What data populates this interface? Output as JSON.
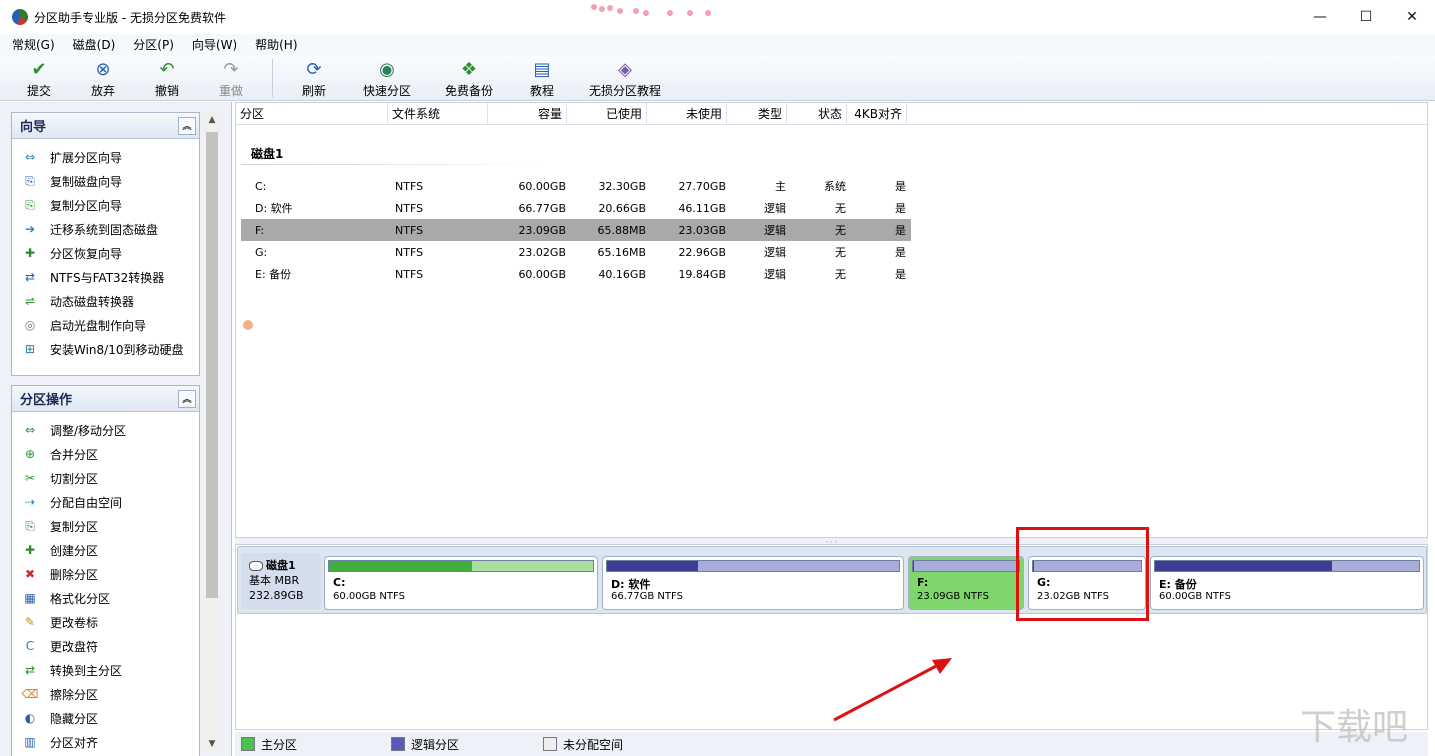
{
  "window": {
    "title": "分区助手专业版 - 无损分区免费软件",
    "minimize": "—",
    "maximize": "☐",
    "close": "✕"
  },
  "menu": [
    "常规(G)",
    "磁盘(D)",
    "分区(P)",
    "向导(W)",
    "帮助(H)"
  ],
  "toolbar": [
    {
      "label": "提交",
      "icon": "check-icon",
      "glyph": "✔",
      "color": "#2f8f2f",
      "enabled": true
    },
    {
      "label": "放弃",
      "icon": "discard-icon",
      "glyph": "⊗",
      "color": "#2a5fb0",
      "enabled": true
    },
    {
      "label": "撤销",
      "icon": "undo-icon",
      "glyph": "↶",
      "color": "#2f8f2f",
      "enabled": true
    },
    {
      "label": "重做",
      "icon": "redo-icon",
      "glyph": "↷",
      "color": "#999999",
      "enabled": false
    },
    {
      "label": "刷新",
      "icon": "refresh-icon",
      "glyph": "⟳",
      "color": "#2a5fb0",
      "enabled": true
    },
    {
      "label": "快速分区",
      "icon": "quick-partition-icon",
      "glyph": "◉",
      "color": "#2a7f5f",
      "enabled": true
    },
    {
      "label": "免费备份",
      "icon": "backup-icon",
      "glyph": "❖",
      "color": "#2f8f2f",
      "enabled": true
    },
    {
      "label": "教程",
      "icon": "tutorial-icon",
      "glyph": "▤",
      "color": "#2a5fb0",
      "enabled": true
    },
    {
      "label": "无损分区教程",
      "icon": "lossless-tutorial-icon",
      "glyph": "◈",
      "color": "#7a5aa0",
      "enabled": true
    }
  ],
  "sidebar": {
    "wizard": {
      "title": "向导",
      "collapse": "︽",
      "items": [
        {
          "label": "扩展分区向导",
          "icon": "extend-partition-icon",
          "glyph": "⇔",
          "color": "#2a7fb0"
        },
        {
          "label": "复制磁盘向导",
          "icon": "copy-disk-icon",
          "glyph": "⎘",
          "color": "#2a5fb0"
        },
        {
          "label": "复制分区向导",
          "icon": "copy-partition-icon",
          "glyph": "⎘",
          "color": "#2f8f2f"
        },
        {
          "label": "迁移系统到固态磁盘",
          "icon": "migrate-os-icon",
          "glyph": "➔",
          "color": "#2a7fb0"
        },
        {
          "label": "分区恢复向导",
          "icon": "partition-recovery-icon",
          "glyph": "✚",
          "color": "#2f8f2f"
        },
        {
          "label": "NTFS与FAT32转换器",
          "icon": "ntfs-fat32-convert-icon",
          "glyph": "⇄",
          "color": "#2a5fb0"
        },
        {
          "label": "动态磁盘转换器",
          "icon": "dynamic-disk-icon",
          "glyph": "⇌",
          "color": "#2f8f2f"
        },
        {
          "label": "启动光盘制作向导",
          "icon": "boot-cd-icon",
          "glyph": "◎",
          "color": "#777777"
        },
        {
          "label": "安装Win8/10到移动硬盘",
          "icon": "windows-to-go-icon",
          "glyph": "⊞",
          "color": "#2a7fb0"
        }
      ]
    },
    "operations": {
      "title": "分区操作",
      "collapse": "︽",
      "items": [
        {
          "label": "调整/移动分区",
          "icon": "resize-partition-icon",
          "glyph": "⇔",
          "color": "#2f8f2f"
        },
        {
          "label": "合并分区",
          "icon": "merge-partition-icon",
          "glyph": "⊕",
          "color": "#2f8f2f"
        },
        {
          "label": "切割分区",
          "icon": "split-partition-icon",
          "glyph": "✂",
          "color": "#2f8f2f"
        },
        {
          "label": "分配自由空间",
          "icon": "allocate-space-icon",
          "glyph": "⇢",
          "color": "#2a7fb0"
        },
        {
          "label": "复制分区",
          "icon": "copy-partition-op-icon",
          "glyph": "⎘",
          "color": "#2f8f2f"
        },
        {
          "label": "创建分区",
          "icon": "create-partition-icon",
          "glyph": "✚",
          "color": "#2f8f2f"
        },
        {
          "label": "删除分区",
          "icon": "delete-partition-icon",
          "glyph": "✖",
          "color": "#c03030"
        },
        {
          "label": "格式化分区",
          "icon": "format-partition-icon",
          "glyph": "▦",
          "color": "#2a5fb0"
        },
        {
          "label": "更改卷标",
          "icon": "change-label-icon",
          "glyph": "✎",
          "color": "#d08020"
        },
        {
          "label": "更改盘符",
          "icon": "change-letter-icon",
          "glyph": "C",
          "color": "#2a7fb0"
        },
        {
          "label": "转换到主分区",
          "icon": "convert-primary-icon",
          "glyph": "⇄",
          "color": "#2f8f2f"
        },
        {
          "label": "擦除分区",
          "icon": "wipe-partition-icon",
          "glyph": "⌫",
          "color": "#d08020"
        },
        {
          "label": "隐藏分区",
          "icon": "hide-partition-icon",
          "glyph": "◐",
          "color": "#2a5fb0"
        },
        {
          "label": "分区对齐",
          "icon": "align-partition-icon",
          "glyph": "▥",
          "color": "#2a5fb0"
        }
      ]
    }
  },
  "table": {
    "columns": [
      "分区",
      "文件系统",
      "容量",
      "已使用",
      "未使用",
      "类型",
      "状态",
      "4KB对齐"
    ],
    "disk_title": "磁盘1",
    "rows": [
      [
        "C:",
        "NTFS",
        "60.00GB",
        "32.30GB",
        "27.70GB",
        "主",
        "系统",
        "是"
      ],
      [
        "D: 软件",
        "NTFS",
        "66.77GB",
        "20.66GB",
        "46.11GB",
        "逻辑",
        "无",
        "是"
      ],
      [
        "F:",
        "NTFS",
        "23.09GB",
        "65.88MB",
        "23.03GB",
        "逻辑",
        "无",
        "是"
      ],
      [
        "G:",
        "NTFS",
        "23.02GB",
        "65.16MB",
        "22.96GB",
        "逻辑",
        "无",
        "是"
      ],
      [
        "E: 备份",
        "NTFS",
        "60.00GB",
        "40.16GB",
        "19.84GB",
        "逻辑",
        "无",
        "是"
      ]
    ],
    "selected_row": 2
  },
  "diskmap": {
    "disk": {
      "name": "磁盘1",
      "type": "基本 MBR",
      "size": "232.89GB"
    },
    "partitions": [
      {
        "name": "C:",
        "info": "60.00GB NTFS",
        "kind": "primary",
        "used_fraction": 0.54,
        "fill_color": "#3fae3f",
        "bar_bg": "#a8e0a0",
        "selected": false
      },
      {
        "name": "D: 软件",
        "info": "66.77GB NTFS",
        "kind": "logical",
        "used_fraction": 0.31,
        "fill_color": "#3c3c94",
        "bar_bg": "#a8acd8",
        "selected": false
      },
      {
        "name": "F:",
        "info": "23.09GB NTFS",
        "kind": "logical",
        "used_fraction": 0.01,
        "fill_color": "#3c3c94",
        "bar_bg": "#a8acd8",
        "selected": true
      },
      {
        "name": "G:",
        "info": "23.02GB NTFS",
        "kind": "logical",
        "used_fraction": 0.01,
        "fill_color": "#3c3c94",
        "bar_bg": "#a8acd8",
        "selected": false
      },
      {
        "name": "E: 备份",
        "info": "60.00GB NTFS",
        "kind": "logical",
        "used_fraction": 0.67,
        "fill_color": "#3c3c94",
        "bar_bg": "#a8acd8",
        "selected": false
      }
    ],
    "splitter": "◦◦◦"
  },
  "legend": [
    {
      "label": "主分区",
      "color": "#4fbf4f"
    },
    {
      "label": "逻辑分区",
      "color": "#5a5ab8"
    },
    {
      "label": "未分配空间",
      "color": "#eeeeee"
    }
  ],
  "colors": {
    "annotation_red": "#dd1111",
    "selected_row": "#a9a9a9",
    "selected_partition": "#7fd66a"
  },
  "watermark": "下载吧"
}
